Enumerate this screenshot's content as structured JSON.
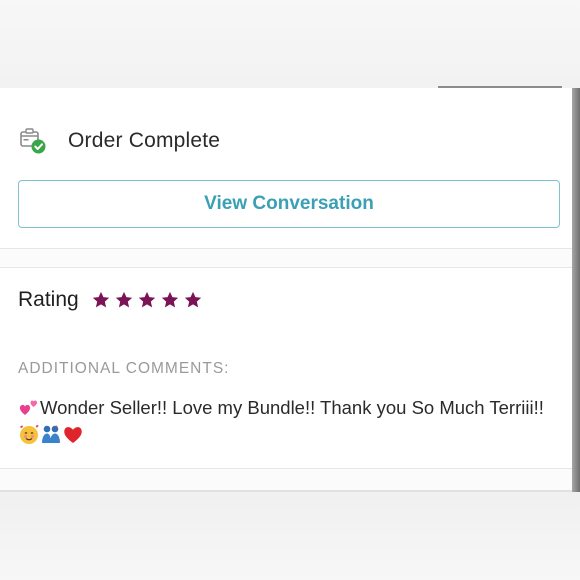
{
  "order": {
    "status": "Order Complete",
    "status_icon": "package-check-icon"
  },
  "conversation_button": {
    "label": "View Conversation"
  },
  "rating": {
    "label": "Rating",
    "stars": 5,
    "star_color": "#7a1454"
  },
  "comments": {
    "header": "ADDITIONAL COMMENTS:",
    "text_before": "Wonder Seller!! Love my Bundle!! Thank you So Much Terriii!!",
    "emojis": [
      "two-hearts-icon",
      "smiling-face-with-hearts-icon",
      "couple-icon",
      "red-heart-icon"
    ]
  },
  "colors": {
    "accent": "#3b9fb6",
    "button_border": "#7ec3cf",
    "check_green": "#3aa648"
  }
}
